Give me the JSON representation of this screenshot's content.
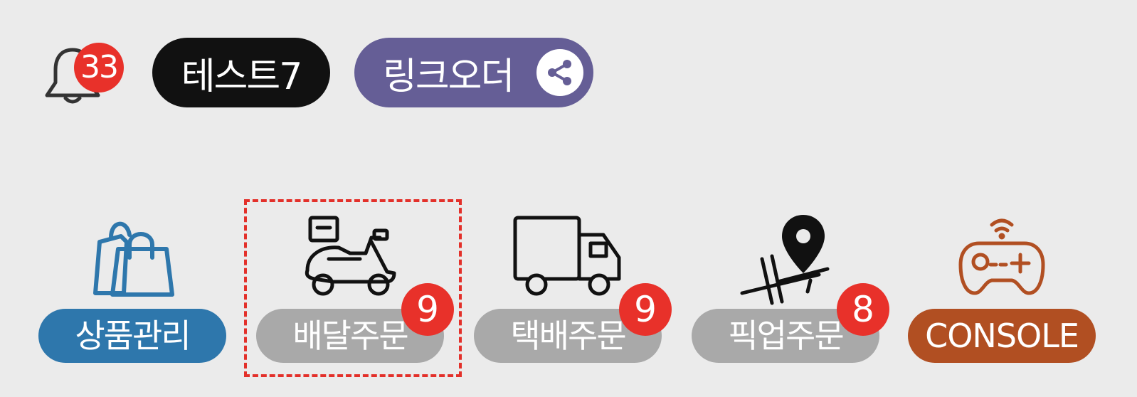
{
  "header": {
    "notification_count": "33",
    "store_name": "테스트7",
    "link_order_label": "링크오더"
  },
  "menu": {
    "products": {
      "label": "상품관리",
      "color": "#2e77ac"
    },
    "delivery": {
      "label": "배달주문",
      "count": "9",
      "color": "#a9a9a9"
    },
    "parcel": {
      "label": "택배주문",
      "count": "9",
      "color": "#a9a9a9"
    },
    "pickup": {
      "label": "픽업주문",
      "count": "8",
      "color": "#a9a9a9"
    },
    "console": {
      "label": "CONSOLE",
      "color": "#b14f22"
    }
  },
  "icons": {
    "bell": "bell-icon",
    "share": "share-icon",
    "products": "shopping-bags-icon",
    "delivery": "scooter-icon",
    "parcel": "truck-icon",
    "pickup": "map-pin-icon",
    "console": "gamepad-icon"
  },
  "colors": {
    "background": "#ebebeb",
    "badge_red": "#e8312a",
    "store_pill": "#111111",
    "link_pill": "#655e96",
    "highlight_border": "#e3302a"
  }
}
